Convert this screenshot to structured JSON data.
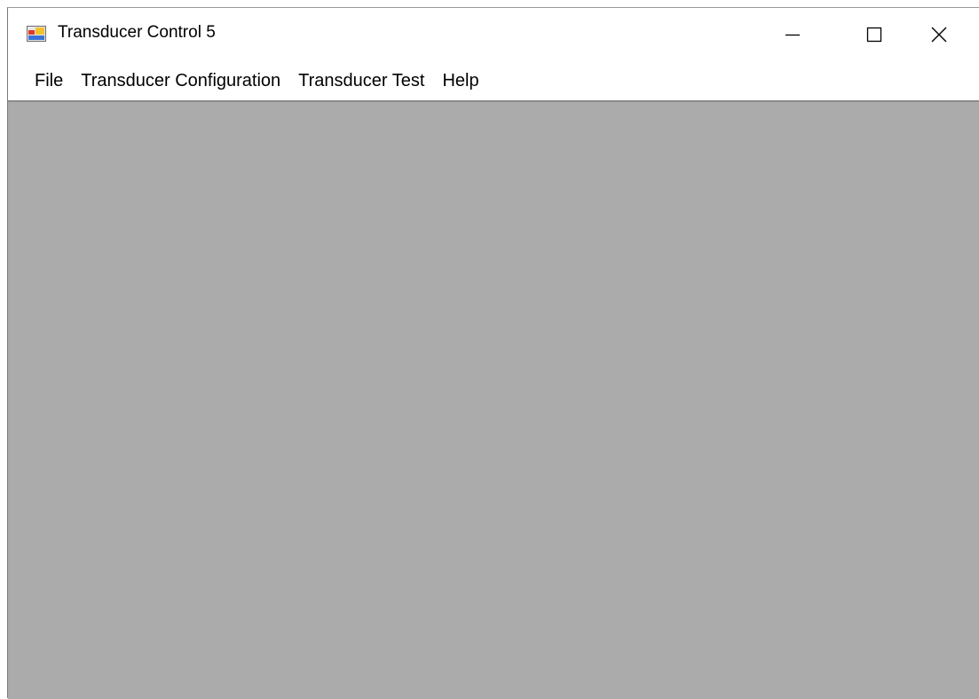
{
  "window": {
    "title": "Transducer Control 5",
    "icon": "app-window-icon"
  },
  "caption_buttons": {
    "minimize_icon": "minimize-icon",
    "maximize_icon": "maximize-icon",
    "close_icon": "close-icon"
  },
  "menubar": {
    "items": [
      {
        "label": "File"
      },
      {
        "label": "Transducer Configuration"
      },
      {
        "label": "Transducer Test"
      },
      {
        "label": "Help"
      }
    ]
  },
  "colors": {
    "client_background": "#ababab",
    "titlebar_background": "#ffffff"
  }
}
